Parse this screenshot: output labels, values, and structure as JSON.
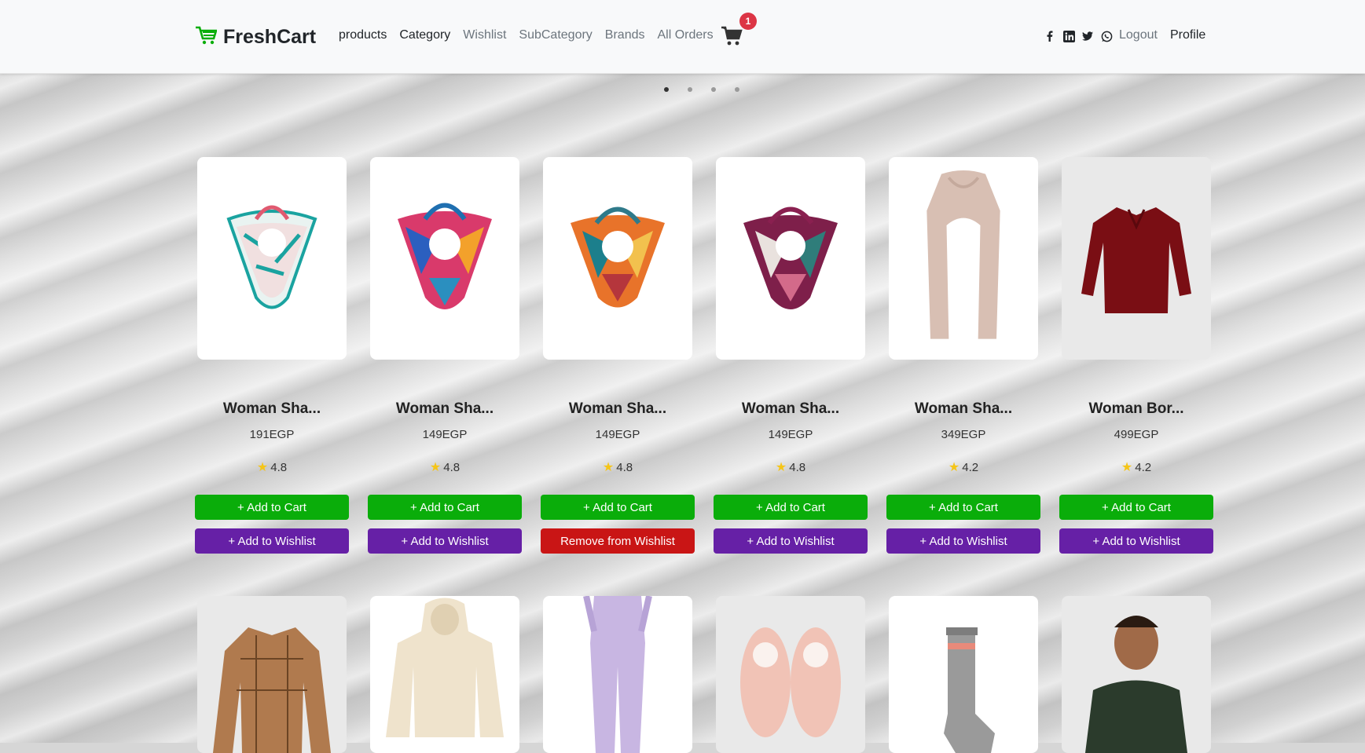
{
  "brand": {
    "name": "FreshCart"
  },
  "nav": {
    "links": [
      "products",
      "Category",
      "Wishlist",
      "SubCategory",
      "Brands",
      "All Orders"
    ],
    "cart_count": "1",
    "logout": "Logout",
    "profile": "Profile"
  },
  "social_icons": [
    "facebook-icon",
    "linkedin-icon",
    "twitter-icon",
    "whatsapp-icon"
  ],
  "slider": {
    "dots": 4,
    "active": 0
  },
  "products": [
    {
      "name": "Woman Sha...",
      "price": "191EGP",
      "rating": "4.8",
      "cart_label": "+ Add to Cart",
      "wish_label": "+ Add to Wishlist",
      "in_wishlist": false
    },
    {
      "name": "Woman Sha...",
      "price": "149EGP",
      "rating": "4.8",
      "cart_label": "+ Add to Cart",
      "wish_label": "+ Add to Wishlist",
      "in_wishlist": false
    },
    {
      "name": "Woman Sha...",
      "price": "149EGP",
      "rating": "4.8",
      "cart_label": "+ Add to Cart",
      "wish_label": "Remove from Wishlist",
      "in_wishlist": true
    },
    {
      "name": "Woman Sha...",
      "price": "149EGP",
      "rating": "4.8",
      "cart_label": "+ Add to Cart",
      "wish_label": "+ Add to Wishlist",
      "in_wishlist": false
    },
    {
      "name": "Woman Sha...",
      "price": "349EGP",
      "rating": "4.2",
      "cart_label": "+ Add to Cart",
      "wish_label": "+ Add to Wishlist",
      "in_wishlist": false
    },
    {
      "name": "Woman Bor...",
      "price": "499EGP",
      "rating": "4.2",
      "cart_label": "+ Add to Cart",
      "wish_label": "+ Add to Wishlist",
      "in_wishlist": false
    }
  ],
  "colors": {
    "green": "#0aad0a",
    "purple": "#6620a6",
    "red": "#c91515",
    "badge": "#dc3545"
  }
}
